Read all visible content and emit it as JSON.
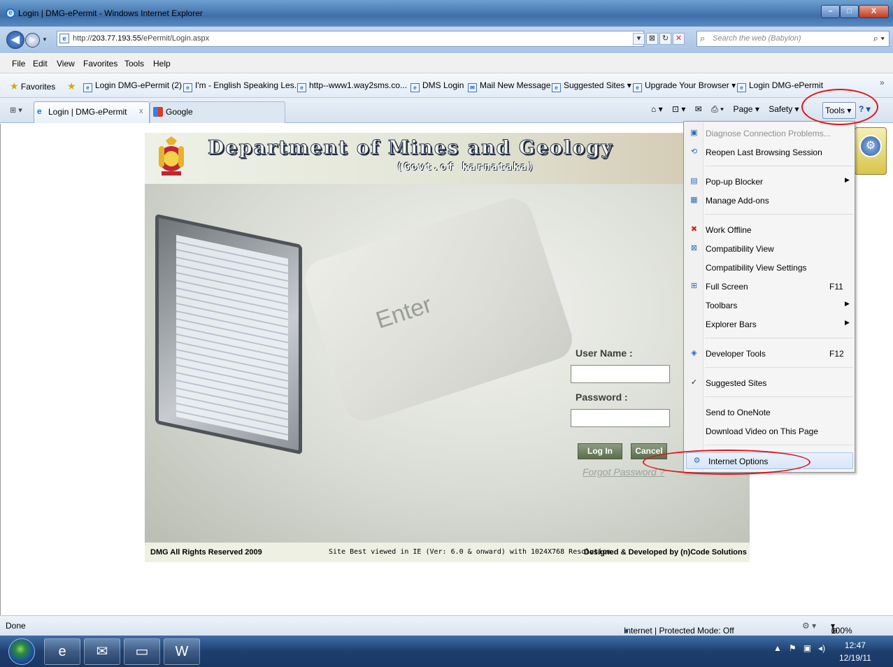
{
  "window": {
    "title": "Login | DMG-ePermit - Windows Internet Explorer"
  },
  "address": {
    "url_prefix": "http://",
    "url_host": "203.77.193.55",
    "url_path": "/ePermit/Login.aspx",
    "search_placeholder": "Search the web (Babylon)"
  },
  "menubar": [
    "File",
    "Edit",
    "View",
    "Favorites",
    "Tools",
    "Help"
  ],
  "favorites": {
    "label": "Favorites",
    "items": [
      "Login DMG-ePermit (2)",
      "I'm - English Speaking Les...",
      "http--www1.way2sms.co...",
      "DMS Login",
      "Mail New Message",
      "Suggested Sites ▾",
      "Upgrade Your Browser ▾",
      "Login DMG-ePermit"
    ]
  },
  "tabs": [
    {
      "label": "Login | DMG-ePermit",
      "close": "x"
    },
    {
      "label": "Google"
    }
  ],
  "commandbar": {
    "page": "Page ▾",
    "safety": "Safety ▾",
    "tools": "Tools ▾"
  },
  "site": {
    "title": "Department of Mines and Geology",
    "subtitle": "(Govt.of karnataka)",
    "key_text": "Enter",
    "user_label": "User Name :",
    "pass_label": "Password :",
    "login_btn": "Log In",
    "cancel_btn": "Cancel",
    "forgot": "Forgot Password ?",
    "footer_left": "DMG All Rights Reserved 2009",
    "footer_mid": "Site Best viewed in IE (Ver: 6.0 & onward) with 1024X768 Resolution",
    "footer_right": "Designed & Developed by (n)Code Solutions"
  },
  "tools_menu": [
    {
      "label": "Diagnose Connection Problems...",
      "disabled": true
    },
    {
      "label": "Reopen Last Browsing Session"
    },
    {
      "label": "Pop-up Blocker"
    },
    {
      "label": "Manage Add-ons"
    },
    {
      "label": "Work Offline"
    },
    {
      "label": "Compatibility View"
    },
    {
      "label": "Compatibility View Settings"
    },
    {
      "label": "Full Screen",
      "shortcut": "F11"
    },
    {
      "label": "Toolbars"
    },
    {
      "label": "Explorer Bars"
    },
    {
      "label": "Developer Tools",
      "shortcut": "F12"
    },
    {
      "label": "Suggested Sites",
      "check": "✓"
    },
    {
      "label": "Send to OneNote"
    },
    {
      "label": "Download Video on This Page"
    },
    {
      "label": "Internet Options"
    }
  ],
  "status": {
    "left": "Done",
    "zone": "Internet | Protected Mode: Off",
    "zoom": "100%"
  },
  "clock": {
    "time": "12:47",
    "date": "12/19/11"
  },
  "colors": {
    "annotation": "#e0141b",
    "taskbar": "#1d3f6f"
  }
}
